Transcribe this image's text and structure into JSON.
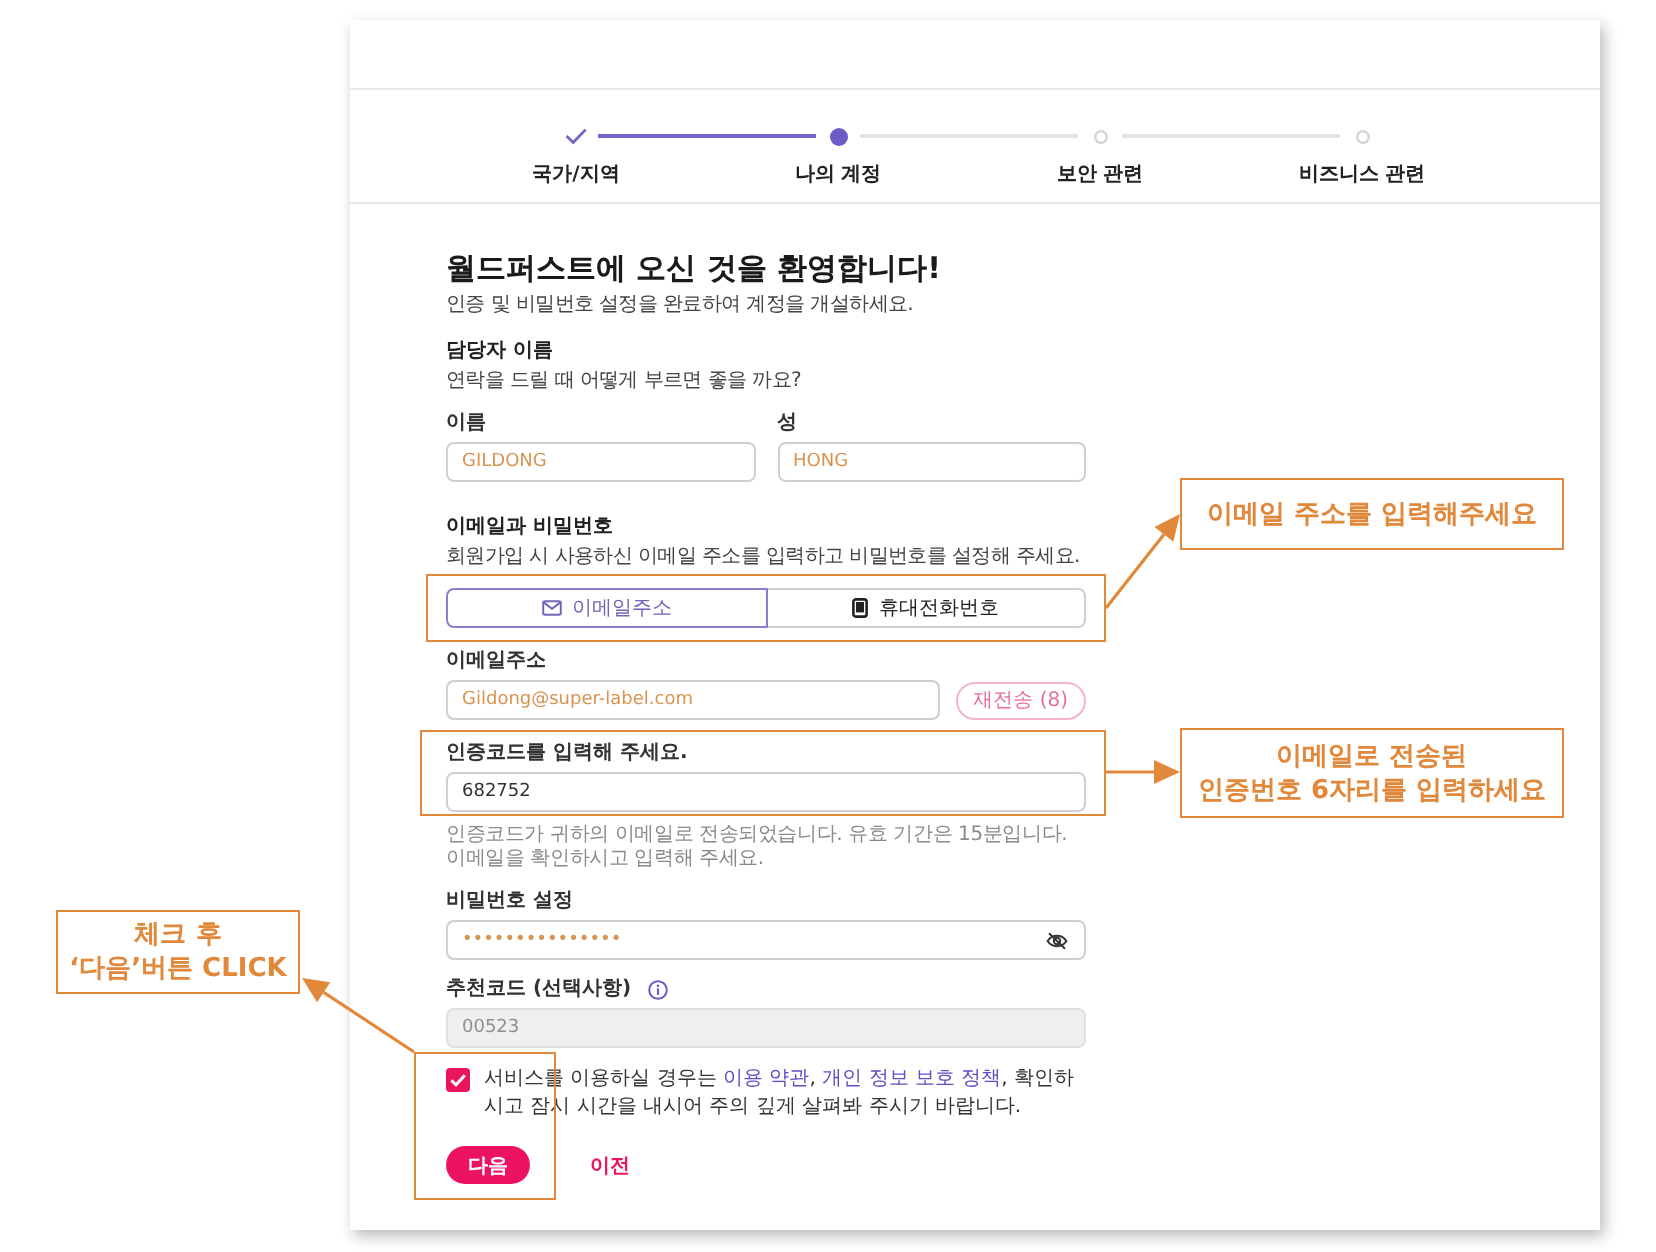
{
  "stepper": {
    "steps": [
      {
        "label": "국가/지역",
        "done": true,
        "current": false
      },
      {
        "label": "나의 계정",
        "done": false,
        "current": true
      },
      {
        "label": "보안 관련",
        "done": false,
        "current": false
      },
      {
        "label": "비즈니스 관련",
        "done": false,
        "current": false
      }
    ]
  },
  "form": {
    "title": "월드퍼스트에 오신 것을 환영합니다!",
    "subtitle": "인증 및 비밀번호 설정을 완료하여 계정을 개설하세요.",
    "contact_name": {
      "heading": "담당자 이름",
      "description": "연락을 드릴 때 어떻게 부르면 좋을 까요?",
      "fields": [
        {
          "label": "이름",
          "value": "GILDONG"
        },
        {
          "label": "성",
          "value": "HONG"
        }
      ]
    },
    "credentials": {
      "heading": "이메일과 비밀번호",
      "description": "회원가입 시 사용하신 이메일 주소를 입력하고 비밀번호를 설정해 주세요.",
      "methods": [
        {
          "kind": "email",
          "label": "이메일주소",
          "selected": true
        },
        {
          "kind": "phone",
          "label": "휴대전화번호",
          "selected": false
        }
      ]
    },
    "email": {
      "label": "이메일주소",
      "value": "Gildong@super-label.com",
      "resend_button": "재전송 (8)"
    },
    "verification": {
      "label": "인증코드를 입력해 주세요.",
      "value": "682752",
      "hint": "인증코드가 귀하의 이메일로 전송되었습니다. 유효 기간은 15분입니다. 이메일을 확인하시고 입력해 주세요."
    },
    "password": {
      "label": "비밀번호 설정",
      "value": "•••••••••••••••"
    },
    "referral": {
      "label": "추천코드 (선택사항)",
      "placeholder": "00523",
      "disabled": true
    },
    "consent": {
      "checked": true,
      "parts": [
        {
          "kind": "text",
          "text": "서비스를 이용하실 경우는 "
        },
        {
          "kind": "link",
          "text": "이용 약관"
        },
        {
          "kind": "text",
          "text": ", "
        },
        {
          "kind": "link",
          "text": "개인 정보 보호 정책"
        },
        {
          "kind": "text",
          "text": ", 확인하시고 잠시 시간을 내시어 주의 깊게 살펴봐 주시기 바랍니다."
        }
      ]
    },
    "next_button": "다음",
    "back_link": "이전"
  },
  "annotations": [
    {
      "text": "이메일 주소를 입력해주세요"
    },
    {
      "text": "이메일로 전송된\n인증번호 6자리를 입력하세요"
    },
    {
      "text": "체크 후\n‘다음’버튼 CLICK"
    }
  ]
}
